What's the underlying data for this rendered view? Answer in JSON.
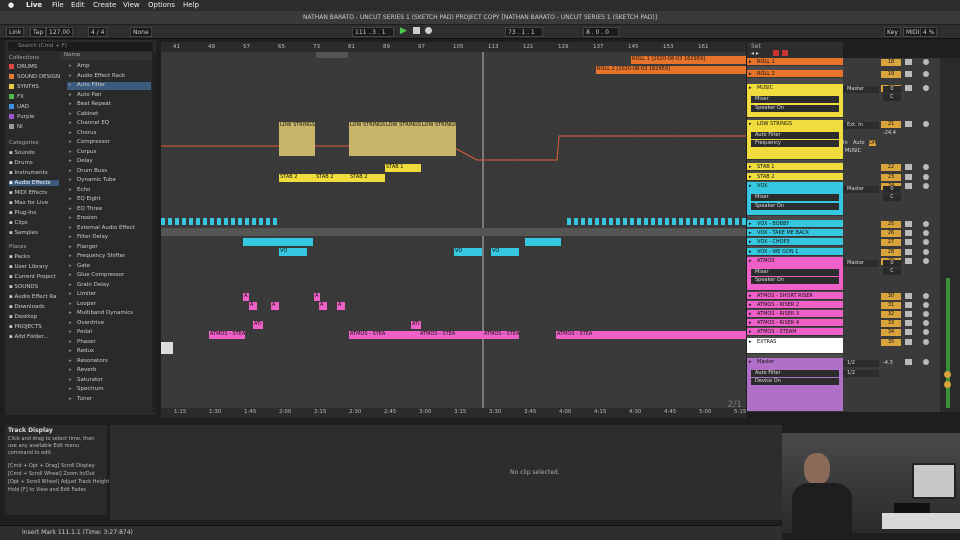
{
  "menubar": {
    "app": "Live",
    "items": [
      "File",
      "Edit",
      "Create",
      "View",
      "Options",
      "Help"
    ]
  },
  "window_title": "NATHAN BARATO - UNCUT SERIES 1 (SKETCH PAD) PROJECT COPY  [NATHAN BARATO - UNCUT SERIES 1 (SKETCH PAD)]",
  "transport": {
    "link": "Link",
    "tap": "Tap",
    "tempo": "127.00",
    "time_sig": "4 / 4",
    "quant": "None",
    "position": "111 .  3 .  1",
    "loop_start": "73 .  1 .  1",
    "loop_len": "8 .  0 .  0",
    "key": "Key",
    "midi": "MIDI",
    "cpu": "4 %"
  },
  "browser": {
    "search": "Search (Cmd + F)",
    "collections_hdr": "Collections",
    "collections": [
      {
        "label": "DRUMS",
        "color": "#e04444"
      },
      {
        "label": "SOUND DESIGN",
        "color": "#e07a30"
      },
      {
        "label": "SYNTHS",
        "color": "#e8c840"
      },
      {
        "label": "FX",
        "color": "#4cb84c"
      },
      {
        "label": "UAD",
        "color": "#3a8ee0"
      },
      {
        "label": "Purple",
        "color": "#9b59d0"
      },
      {
        "label": "NI",
        "color": "#999999"
      }
    ],
    "categories_hdr": "Categories",
    "categories": [
      "Sounds",
      "Drums",
      "Instruments",
      "Audio Effects",
      "MIDI Effects",
      "Max for Live",
      "Plug-Ins",
      "Clips",
      "Samples"
    ],
    "places_hdr": "Places",
    "places": [
      "Packs",
      "User Library",
      "Current Project",
      "SOUNDS",
      "Audio Effect Ra",
      "Downloads",
      "Desktop",
      "PROJECTS",
      "Add Folder..."
    ],
    "name_hdr": "Name",
    "items": [
      "Amp",
      "Audio Effect Rack",
      "Auto Filter",
      "Auto Pan",
      "Beat Repeat",
      "Cabinet",
      "Channel EQ",
      "Chorus",
      "Compressor",
      "Corpus",
      "Delay",
      "Drum Buss",
      "Dynamic Tube",
      "Echo",
      "EQ Eight",
      "EQ Three",
      "Erosion",
      "External Audio Effect",
      "Filter Delay",
      "Flanger",
      "Frequency Shifter",
      "Gate",
      "Glue Compressor",
      "Grain Delay",
      "Limiter",
      "Looper",
      "Multiband Dynamics",
      "Overdrive",
      "Pedal",
      "Phaser",
      "Redux",
      "Resonators",
      "Reverb",
      "Saturator",
      "Spectrum",
      "Tuner"
    ]
  },
  "ruler_bars": [
    "41",
    "49",
    "57",
    "65",
    "73",
    "81",
    "89",
    "97",
    "105",
    "113",
    "121",
    "129",
    "137",
    "145",
    "153",
    "161"
  ],
  "time_marks": [
    "1:15",
    "1:30",
    "1:45",
    "2:00",
    "2:15",
    "2:30",
    "2:45",
    "3:00",
    "3:15",
    "3:30",
    "3:45",
    "4:00",
    "4:15",
    "4:30",
    "4:45",
    "5:00",
    "5:15"
  ],
  "clips": {
    "roll1": "ROLL 1 [2020-08-03 162959]",
    "roll2": "ROLL 2 [2020-08-03 162959]",
    "low_strings": "LOW STRINGS",
    "stab1": "STAB 1",
    "stab2": "STAB 2",
    "vox": "VO",
    "atmos_short": "A",
    "atmos_steam": "ATMOS - STEA",
    "atmos_riser": "ATI"
  },
  "zoom": "2/1",
  "tracks": [
    {
      "name": "ROLL 1",
      "color": "#e8742c",
      "num": "18"
    },
    {
      "name": "ROLL 2",
      "color": "#e8742c",
      "num": "19"
    },
    {
      "name": "MUSIC",
      "color": "#f0dc3c",
      "num": "20"
    },
    {
      "name": "LOW STRINGS",
      "color": "#f0dc3c",
      "num": "21"
    },
    {
      "name": "STAB 1",
      "color": "#f0dc3c",
      "num": "22"
    },
    {
      "name": "STAB 2",
      "color": "#f0dc3c",
      "num": "23"
    },
    {
      "name": "VOX",
      "color": "#35c8e0",
      "num": "24"
    },
    {
      "name": "VOX - BOBBY",
      "color": "#35c8e0",
      "num": "25"
    },
    {
      "name": "VOX - TAKE ME BACK",
      "color": "#35c8e0",
      "num": "26"
    },
    {
      "name": "VOX - CHOP3",
      "color": "#35c8e0",
      "num": "27"
    },
    {
      "name": "VOX - WE GON 1",
      "color": "#35c8e0",
      "num": "28"
    },
    {
      "name": "ATMOS",
      "color": "#f060c8",
      "num": "29"
    },
    {
      "name": "ATMOS - SHORT RISER",
      "color": "#f060c8",
      "num": "30"
    },
    {
      "name": "ATMOS - RISER 2",
      "color": "#f060c8",
      "num": "31"
    },
    {
      "name": "ATMOS - RISER 3",
      "color": "#f060c8",
      "num": "32"
    },
    {
      "name": "ATMOS - RISER 4",
      "color": "#f060c8",
      "num": "33"
    },
    {
      "name": "ATMOS - STEAM",
      "color": "#f060c8",
      "num": "34"
    },
    {
      "name": "EXTRAS",
      "color": "#ffffff",
      "num": "35"
    },
    {
      "name": "Master",
      "color": "#b070c8",
      "num": ""
    }
  ],
  "devices": {
    "mixer": "Mixer",
    "speaker": "Speaker On",
    "auto_filter": "Auto Filter",
    "frequency": "Frequency",
    "device_on": "Device On",
    "master_out": "Master",
    "ext_in": "Ext. In",
    "in": "In",
    "auto": "Auto",
    "off": "Off",
    "music": "MUSIC",
    "half": "1/2",
    "vol_low": "-24.4",
    "vol_master": "-4.3",
    "zero": "0",
    "c": "C"
  },
  "info": {
    "title": "Track Display",
    "body": "Click and drag to select time, then use any available Edit menu command to edit.",
    "shortcuts": [
      "[Cmd + Opt + Drag] Scroll Display",
      "[Cmd + Scroll Wheel] Zoom In/Out",
      "[Opt + Scroll Wheel] Adjust Track Height",
      "Hold [F] to View and Edit Fades"
    ]
  },
  "detail_text": "No clip selected.",
  "status": "Insert Mark 111.1.1 (Time: 3:27:874)",
  "set_label": "Set"
}
